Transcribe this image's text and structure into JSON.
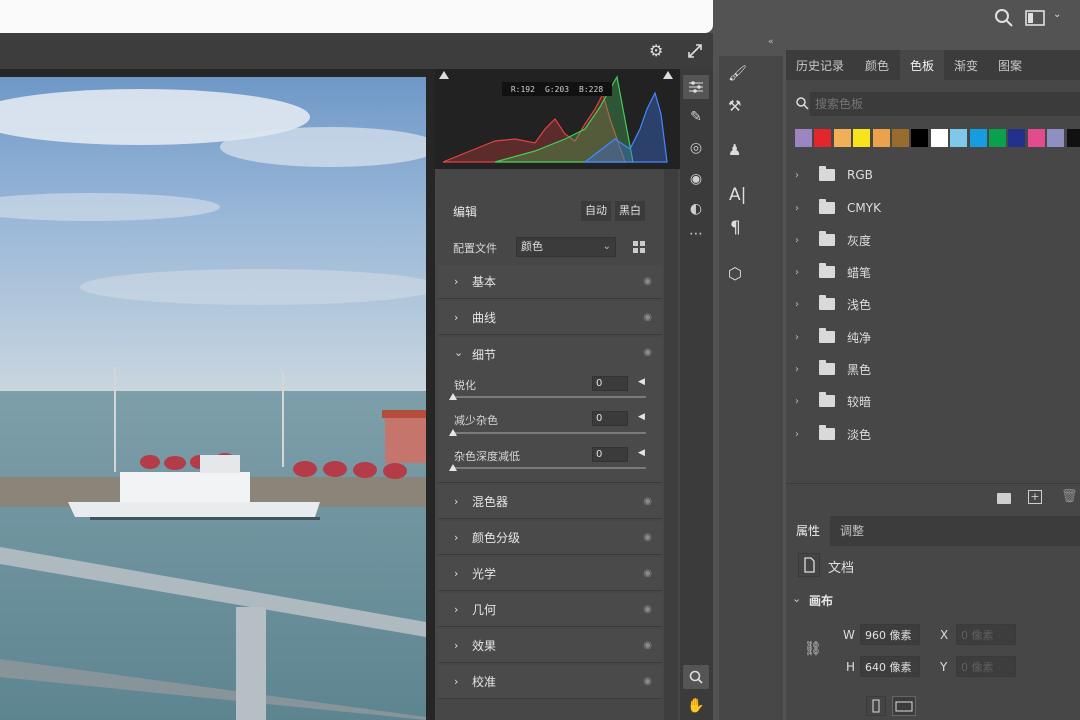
{
  "colors": {
    "accent": "#4b9bd3",
    "panel": "#474747",
    "dark": "#262626"
  },
  "histogram": {
    "r": "R:192",
    "g": "G:203",
    "b": "B:228"
  },
  "camera_raw": {
    "edit_label": "编辑",
    "auto_label": "自动",
    "bw_label": "黑白",
    "profile_label": "配置文件",
    "profile_value": "颜色",
    "sections": {
      "basic": "基本",
      "curve": "曲线",
      "detail": "细节",
      "mixer": "混色器",
      "grading": "颜色分级",
      "optics": "光学",
      "geometry": "几何",
      "effects": "效果",
      "calibration": "校准"
    },
    "sliders": [
      {
        "label": "锐化",
        "value": "0",
        "level": 0
      },
      {
        "label": "减少杂色",
        "value": "0",
        "level": 0
      },
      {
        "label": "杂色深度减低",
        "value": "0",
        "level": 0
      }
    ]
  },
  "ps_panel": {
    "tabs": [
      "历史记录",
      "颜色",
      "色板",
      "渐变",
      "图案"
    ],
    "active_tab": "色板",
    "search_placeholder": "搜索色板",
    "swatches": [
      "#9b86c2",
      "#e3262a",
      "#f1b058",
      "#f8e41a",
      "#eaa34c",
      "#9a6b2f",
      "#000000",
      "#ffffff",
      "#7ec9ea",
      "#159de0",
      "#0aa04c",
      "#23318c",
      "#e24c8c",
      "#8f90c2",
      "#111111"
    ],
    "groups": [
      "RGB",
      "CMYK",
      "灰度",
      "蜡笔",
      "浅色",
      "纯净",
      "黑色",
      "较暗",
      "淡色"
    ]
  },
  "properties": {
    "tabs": [
      "属性",
      "调整"
    ],
    "doc_label": "文档",
    "canvas_label": "画布",
    "w_label": "W",
    "w_value": "960 像素",
    "h_label": "H",
    "h_value": "640 像素",
    "x_label": "X",
    "x_placeholder": "0 像素",
    "y_label": "Y",
    "y_placeholder": "0 像素"
  }
}
